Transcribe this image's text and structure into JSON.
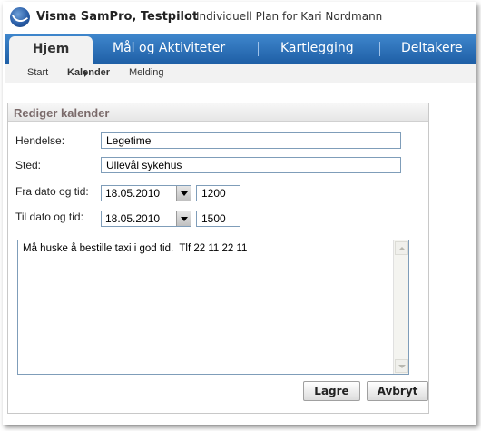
{
  "header": {
    "app_title": "Visma SamPro, Testpilot",
    "plan_title": "Individuell Plan for Kari Nordmann",
    "logo_icon": "visma-logo-icon"
  },
  "tabs": [
    {
      "label": "Hjem",
      "active": true
    },
    {
      "label": "Mål og Aktiviteter",
      "active": false
    },
    {
      "label": "Kartlegging",
      "active": false
    },
    {
      "label": "Deltakere",
      "active": false
    }
  ],
  "subnav": [
    {
      "label": "Start",
      "active": false
    },
    {
      "label": "Kalender",
      "active": true
    },
    {
      "label": "Melding",
      "active": false
    }
  ],
  "panel": {
    "title": "Rediger kalender",
    "fields": {
      "event_label": "Hendelse:",
      "event_value": "Legetime",
      "place_label": "Sted:",
      "place_value": "Ullevål sykehus",
      "from_label": "Fra dato og tid:",
      "from_date": "18.05.2010",
      "from_time": "1200",
      "to_label": "Til dato og tid:",
      "to_date": "18.05.2010",
      "to_time": "1500"
    },
    "note": "Må huske å bestille taxi i god tid.  Tlf 22 11 22 11"
  },
  "buttons": {
    "save": "Lagre",
    "cancel": "Avbryt"
  },
  "colors": {
    "tabbar": "#2a6db6",
    "accent": "#1f5fa6"
  }
}
